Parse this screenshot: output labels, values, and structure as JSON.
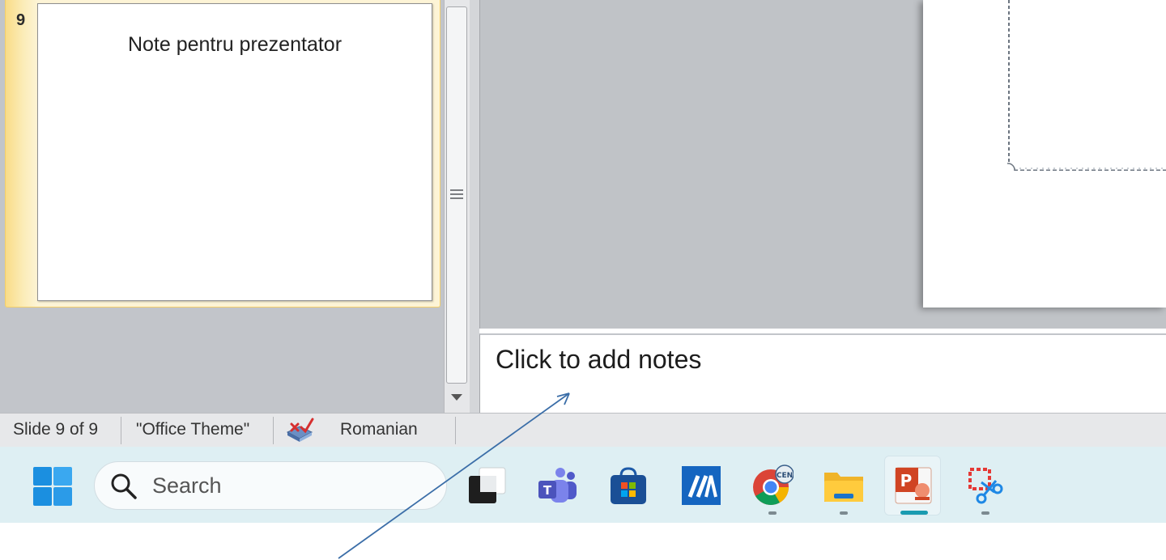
{
  "slides_panel": {
    "selected_slide_number": "9",
    "selected_slide_title": "Note pentru prezentator"
  },
  "notes": {
    "placeholder": "Click to add notes"
  },
  "status_bar": {
    "slide_indicator": "Slide 9 of 9",
    "theme": "\"Office Theme\"",
    "language": "Romanian",
    "spell_icon": "spell-check-icon"
  },
  "taskbar": {
    "search_label": "Search",
    "apps": [
      {
        "name": "start",
        "icon": "windows-logo-icon"
      },
      {
        "name": "task-view",
        "icon": "task-view-icon"
      },
      {
        "name": "teams",
        "icon": "teams-icon"
      },
      {
        "name": "store",
        "icon": "microsoft-store-icon"
      },
      {
        "name": "app",
        "icon": "blue-app-icon"
      },
      {
        "name": "chrome",
        "icon": "chrome-icon"
      },
      {
        "name": "file-explorer",
        "icon": "folder-icon"
      },
      {
        "name": "powerpoint",
        "icon": "powerpoint-icon"
      },
      {
        "name": "snipping-tool",
        "icon": "snipping-tool-icon"
      }
    ]
  },
  "colors": {
    "selected_slide_highlight": "#f9dc88",
    "taskbar_background": "#deeff3",
    "active_indicator": "#1a9bb0",
    "arrow": "#3b6ea8"
  }
}
